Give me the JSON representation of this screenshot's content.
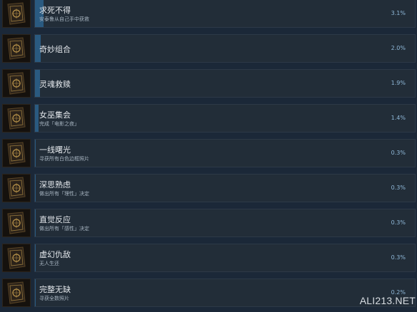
{
  "achievements": [
    {
      "title": "求死不得",
      "description": "安泰鲁从自己手中获救",
      "percent": "3.1%",
      "percent_value": 3.1,
      "icon": "book-ornament-icon"
    },
    {
      "title": "奇妙组合",
      "description": "",
      "percent": "2.0%",
      "percent_value": 2.0,
      "icon": "book-ornament-icon"
    },
    {
      "title": "灵魂救赎",
      "description": "",
      "percent": "1.9%",
      "percent_value": 1.9,
      "icon": "book-ornament-icon"
    },
    {
      "title": "女巫集会",
      "description": "完成「电影之夜」",
      "percent": "1.4%",
      "percent_value": 1.4,
      "icon": "book-ornament-icon"
    },
    {
      "title": "一线曙光",
      "description": "寻获所有白色边框照片",
      "percent": "0.3%",
      "percent_value": 0.3,
      "icon": "book-ornament-icon"
    },
    {
      "title": "深思熟虑",
      "description": "做出所有「理性」决定",
      "percent": "0.3%",
      "percent_value": 0.3,
      "icon": "book-ornament-icon"
    },
    {
      "title": "直觉反应",
      "description": "做出所有「感性」决定",
      "percent": "0.3%",
      "percent_value": 0.3,
      "icon": "book-ornament-icon"
    },
    {
      "title": "虚幻仇敌",
      "description": "无人生还",
      "percent": "0.3%",
      "percent_value": 0.3,
      "icon": "book-ornament-icon"
    },
    {
      "title": "完整无缺",
      "description": "寻获全数照片",
      "percent": "0.2%",
      "percent_value": 0.2,
      "icon": "book-ornament-icon"
    }
  ],
  "watermark": "ALI213.NET",
  "colors": {
    "background": "#1b2838",
    "row": "#222d38",
    "progress_fill": "#2a5a80",
    "percent_text": "#8fb8d8",
    "icon_gold": "#b8934a"
  }
}
